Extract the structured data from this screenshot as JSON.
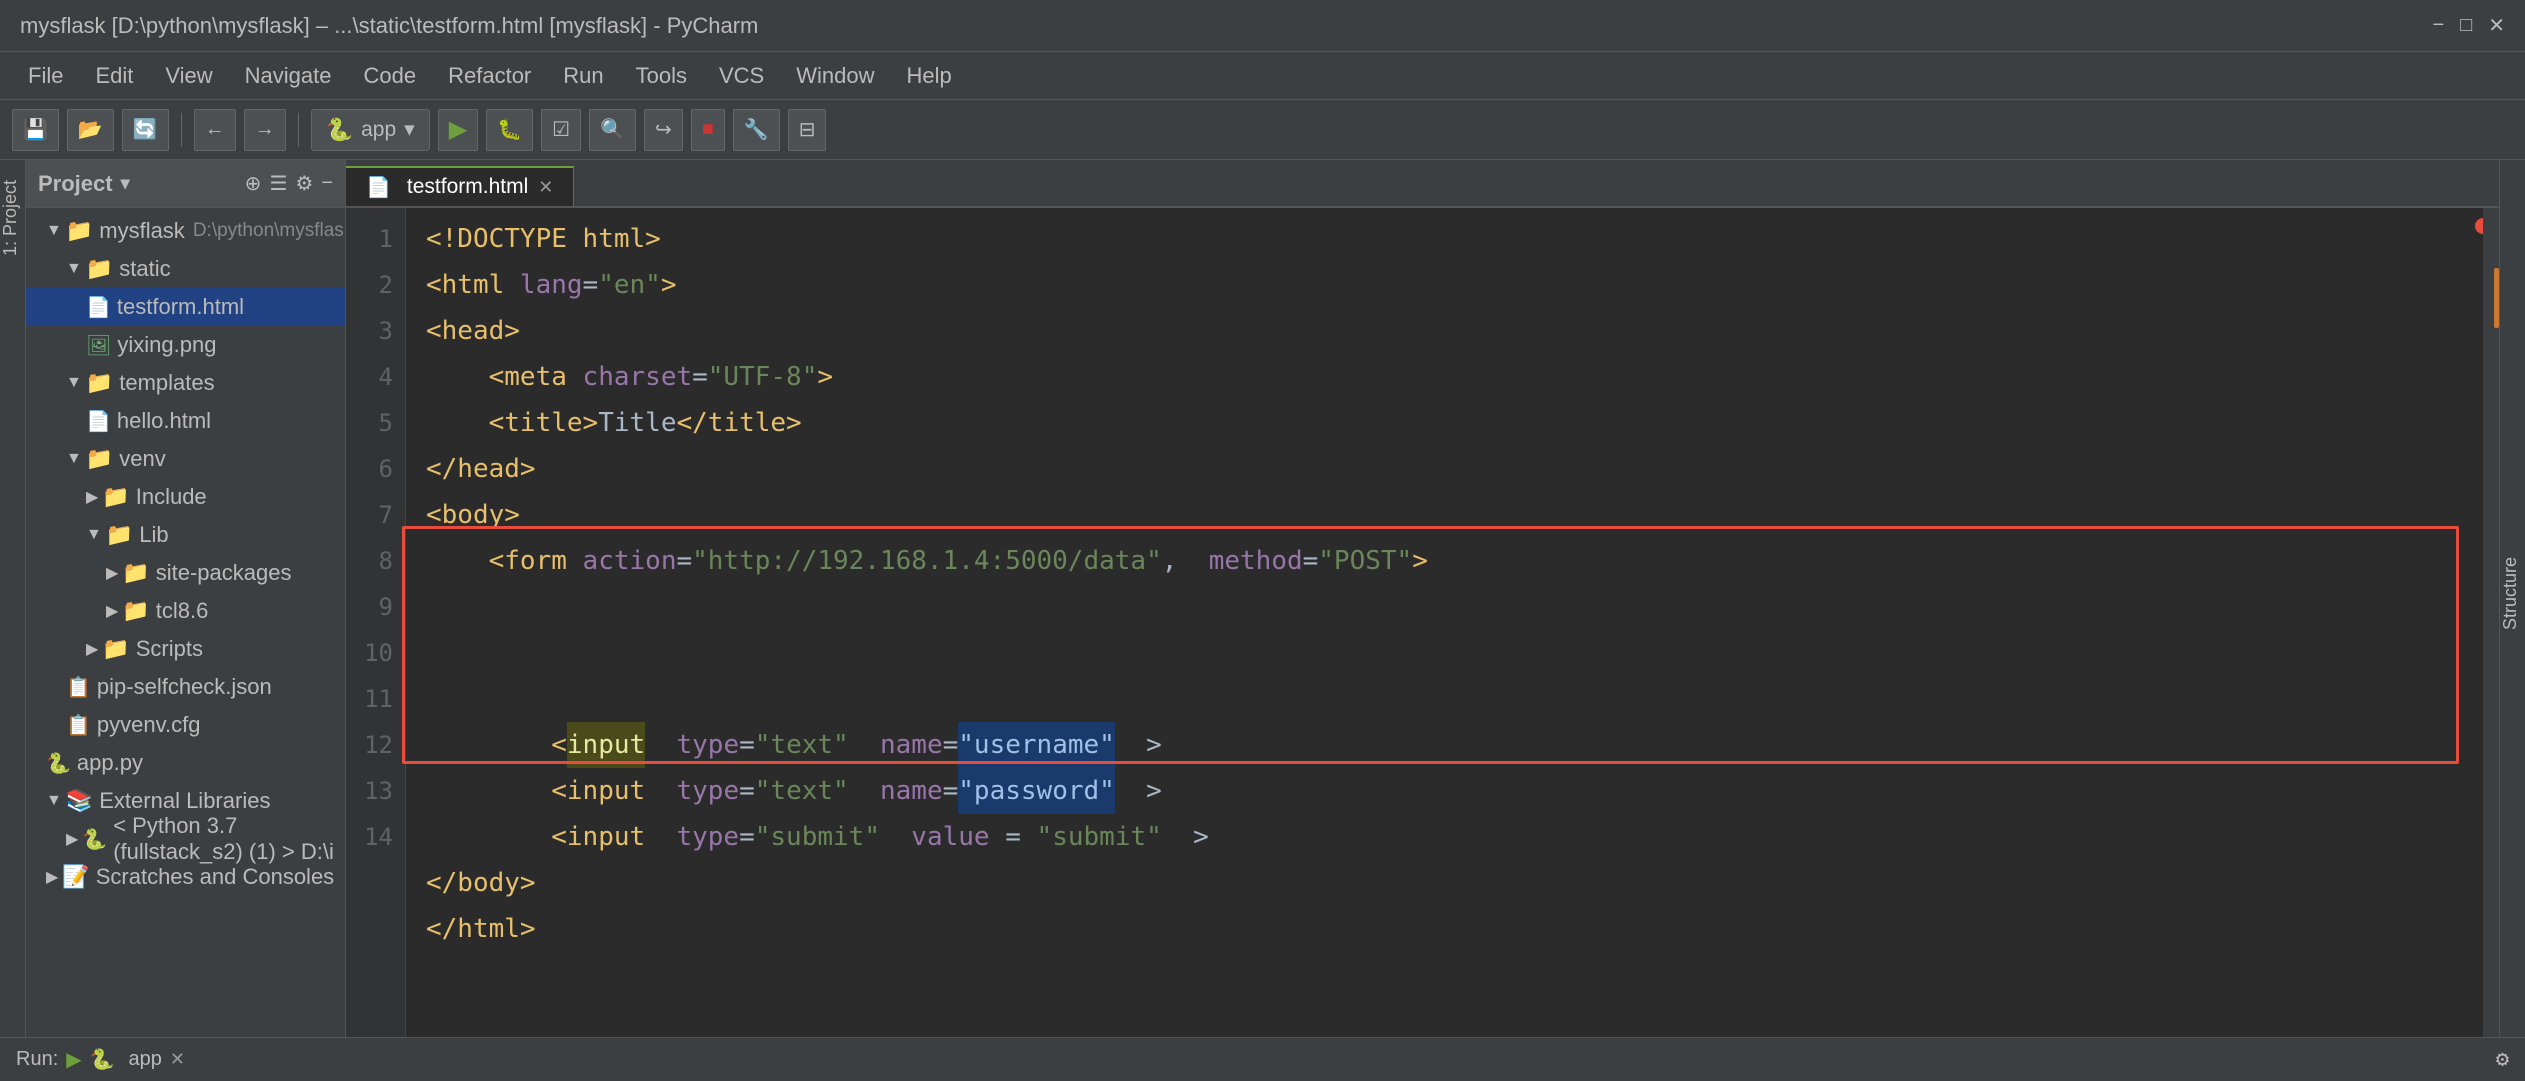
{
  "window": {
    "title": "mysflask [D:\\python\\mysflask] – ...\\static\\testform.html [mysflask] - PyCharm",
    "minimize": "−",
    "maximize": "□",
    "close": "✕"
  },
  "menubar": {
    "items": [
      "File",
      "Edit",
      "View",
      "Navigate",
      "Code",
      "Refactor",
      "Run",
      "Tools",
      "VCS",
      "Window",
      "Help"
    ]
  },
  "toolbar": {
    "app_label": "app",
    "app_dropdown": "▾"
  },
  "project": {
    "title": "Project",
    "tree": [
      {
        "level": 1,
        "type": "folder",
        "name": "mysflask",
        "extra": "D:\\python\\mysflask",
        "expanded": true
      },
      {
        "level": 2,
        "type": "folder",
        "name": "static",
        "expanded": true
      },
      {
        "level": 3,
        "type": "file-html",
        "name": "testform.html",
        "active": true
      },
      {
        "level": 3,
        "type": "file-png",
        "name": "yixing.png"
      },
      {
        "level": 2,
        "type": "folder",
        "name": "templates",
        "expanded": true
      },
      {
        "level": 3,
        "type": "file-html",
        "name": "hello.html"
      },
      {
        "level": 2,
        "type": "folder",
        "name": "venv",
        "expanded": true
      },
      {
        "level": 3,
        "type": "folder",
        "name": "Include",
        "expanded": false
      },
      {
        "level": 3,
        "type": "folder",
        "name": "Lib",
        "expanded": true
      },
      {
        "level": 4,
        "type": "folder",
        "name": "site-packages",
        "expanded": false
      },
      {
        "level": 4,
        "type": "folder",
        "name": "tcl8.6",
        "expanded": false
      },
      {
        "level": 3,
        "type": "folder",
        "name": "Scripts",
        "expanded": false
      },
      {
        "level": 2,
        "type": "file-json",
        "name": "pip-selfcheck.json"
      },
      {
        "level": 2,
        "type": "file-cfg",
        "name": "pyvenv.cfg"
      },
      {
        "level": 1,
        "type": "file-py",
        "name": "app.py"
      },
      {
        "level": 1,
        "type": "folder",
        "name": "External Libraries",
        "expanded": true
      },
      {
        "level": 2,
        "type": "folder",
        "name": "< Python 3.7 (fullstack_s2) (1) > D:\\i",
        "expanded": false
      },
      {
        "level": 1,
        "type": "folder",
        "name": "Scratches and Consoles",
        "expanded": false
      }
    ]
  },
  "editor": {
    "tab": "testform.html",
    "lines": [
      {
        "num": 1,
        "content": "<!DOCTYPE html>"
      },
      {
        "num": 2,
        "content": "<html lang=\"en\">"
      },
      {
        "num": 3,
        "content": "<head>"
      },
      {
        "num": 4,
        "content": "    <meta charset=\"UTF-8\">"
      },
      {
        "num": 5,
        "content": "    <title>Title</title>"
      },
      {
        "num": 6,
        "content": "</head>"
      },
      {
        "num": 7,
        "content": "<body>"
      },
      {
        "num": 8,
        "content": "    <form action=\"http://192.168.1.4:5000/data\",  method=\"POST\">"
      },
      {
        "num": 9,
        "content": ""
      },
      {
        "num": 10,
        "content": "        <input  type=\"text\"  name=\"username\"  >"
      },
      {
        "num": 11,
        "content": "        <input  type=\"text\"  name=\"password\"  >"
      },
      {
        "num": 12,
        "content": "        <input  type=\"submit\"  value = \"submit\"  >"
      },
      {
        "num": 13,
        "content": "</body>"
      },
      {
        "num": 14,
        "content": "</html>"
      }
    ]
  },
  "statusbar": {
    "run_label": "Run:",
    "app_label": "app",
    "close": "✕"
  },
  "icons": {
    "folder": "📁",
    "file_html": "📄",
    "file_png": "🖼",
    "file_py": "🐍",
    "file_json": "📋",
    "file_cfg": "📋",
    "gear": "⚙",
    "run_green": "▶"
  }
}
